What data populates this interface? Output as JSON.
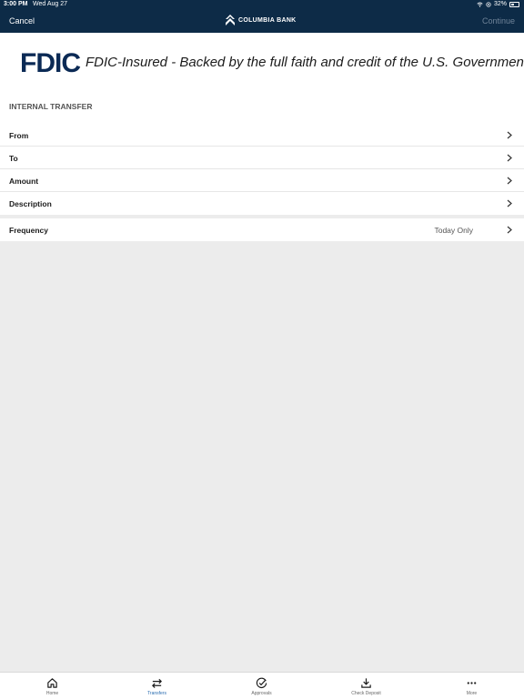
{
  "status_bar": {
    "time": "3:00 PM",
    "date": "Wed Aug 27",
    "battery": "32%"
  },
  "nav": {
    "cancel_label": "Cancel",
    "brand": "COLUMBIA BANK",
    "continue_label": "Continue"
  },
  "fdic": {
    "logo": "FDIC",
    "text": "FDIC-Insured - Backed by the full faith and credit of the U.S. Government"
  },
  "section": {
    "title": "INTERNAL TRANSFER"
  },
  "form_rows": [
    {
      "label": "From"
    },
    {
      "label": "To"
    },
    {
      "label": "Amount"
    },
    {
      "label": "Description"
    }
  ],
  "frequency": {
    "label": "Frequency",
    "value": "Today Only"
  },
  "tabs": [
    {
      "label": "Home",
      "icon": "home-icon"
    },
    {
      "label": "Transfers",
      "icon": "transfer-icon"
    },
    {
      "label": "Approvals",
      "icon": "check-circle-icon"
    },
    {
      "label": "Check Deposit",
      "icon": "download-icon"
    },
    {
      "label": "More",
      "icon": "more-icon"
    }
  ],
  "colors": {
    "header_bg": "#0d2b47",
    "active_tab": "#2a6db0",
    "fdic_blue": "#0b2a55"
  }
}
